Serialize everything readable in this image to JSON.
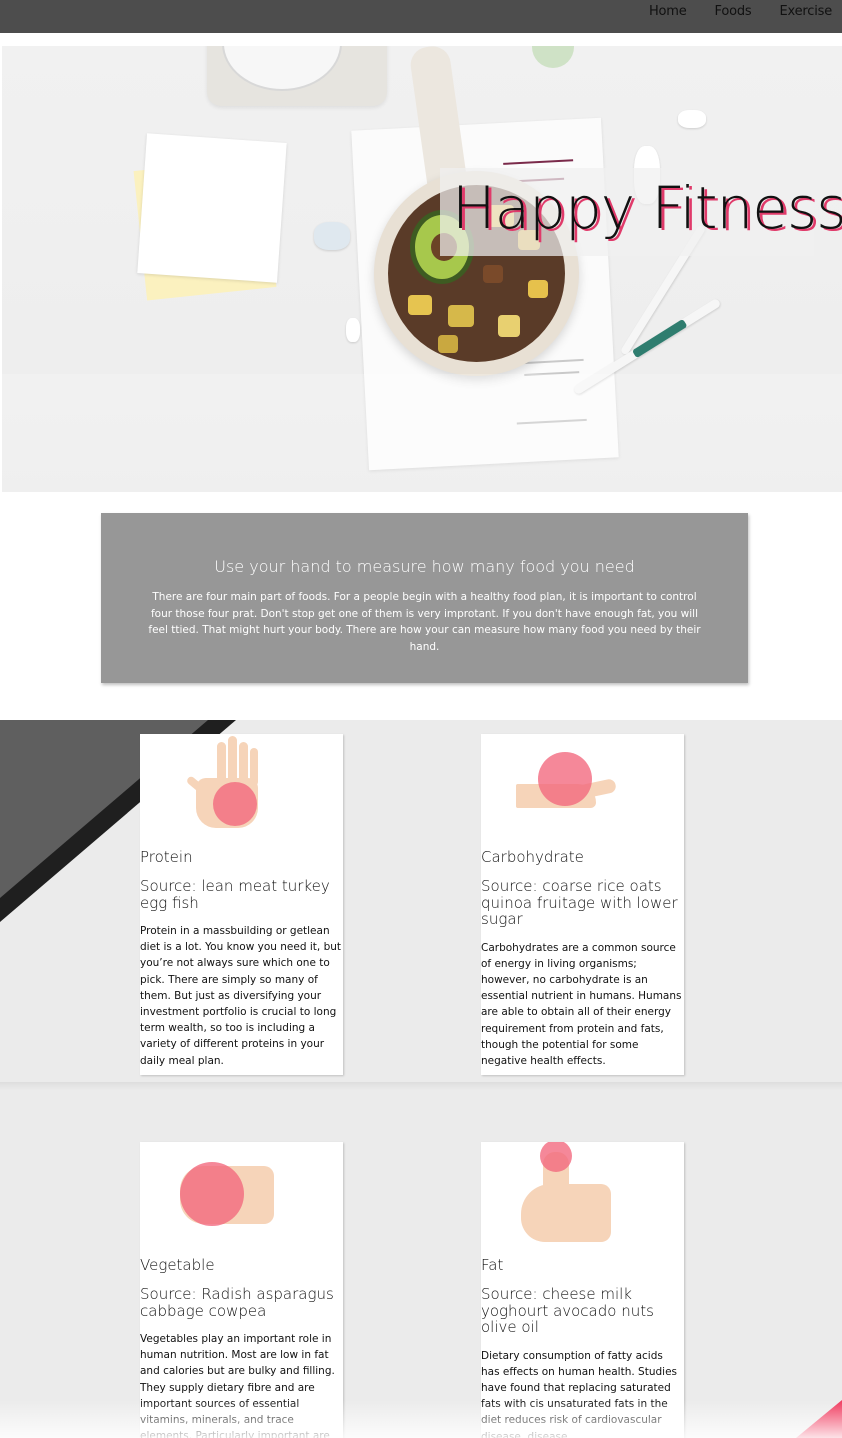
{
  "nav": {
    "items": [
      {
        "label": "Home"
      },
      {
        "label": "Foods"
      },
      {
        "label": "Exercise"
      }
    ]
  },
  "hero": {
    "title": "Happy Fitness"
  },
  "intro": {
    "heading": "Use your hand to measure how many food you need",
    "body": "There are four main part of foods. For a people begin with a healthy food plan, it is important to control four those four prat. Don't stop get one of them is very improtant. If you don't have enough fat, you will feel ttied. That might hurt your body. There are how your can measure how many food you need by their hand."
  },
  "foods": [
    {
      "title": "Protein",
      "source": "Source: lean meat turkey egg fish",
      "description": "Protein in a massbuilding or getlean diet is a lot. You know you need it, but you’re not always sure which one to pick. There are simply so many of them. But just as diversifying your investment portfolio is crucial to long term wealth, so too is including a variety of different proteins in your daily meal plan."
    },
    {
      "title": "Carbohydrate",
      "source": "Source: coarse rice oats quinoa fruitage with lower sugar",
      "description": "Carbohydrates are a common source of energy in living organisms; however, no carbohydrate is an essential nutrient in humans. Humans are able to obtain all of their energy requirement from protein and fats, though the potential for some negative health effects."
    },
    {
      "title": "Vegetable",
      "source": "Source: Radish asparagus cabbage cowpea",
      "description": "Vegetables play an important role in human nutrition. Most are low in fat and calories but are bulky and filling. They supply dietary fibre and are important sources of essential vitamins, minerals, and trace elements. Particularly important are the"
    },
    {
      "title": "Fat",
      "source": "Source: cheese milk yoghourt avocado nuts olive oil",
      "description": "Dietary consumption of fatty acids has effects on human health. Studies have found that replacing saturated fats with cis unsaturated fats in the diet reduces risk of cardiovascular disease. disease"
    }
  ],
  "colors": {
    "nav_bg": "#4d4d4d",
    "intro_bg": "#979797",
    "section_bg": "#ebebeb",
    "accent_pink": "#f2667c",
    "title_shadow": "#e03a6a"
  }
}
